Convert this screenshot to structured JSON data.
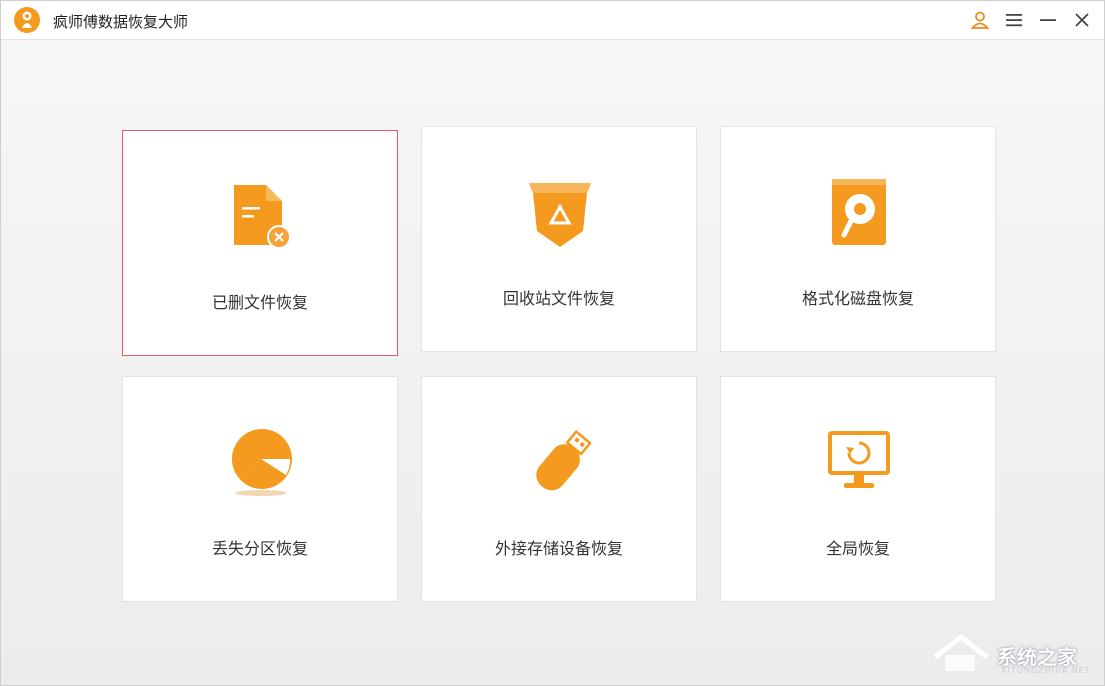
{
  "window": {
    "title": "疯师傅数据恢复大师",
    "accent_color": "#f08a1c"
  },
  "titlebar_controls": {
    "user_icon": "user-icon",
    "menu_icon": "hamburger-menu-icon",
    "minimize_icon": "minimize-icon",
    "close_icon": "close-icon"
  },
  "cards": [
    {
      "label": "已删文件恢复",
      "icon": "deleted-file-icon",
      "selected": true
    },
    {
      "label": "回收站文件恢复",
      "icon": "recycle-bin-icon",
      "selected": false
    },
    {
      "label": "格式化磁盘恢复",
      "icon": "formatted-disk-icon",
      "selected": false
    },
    {
      "label": "丢失分区恢复",
      "icon": "pie-partition-icon",
      "selected": false
    },
    {
      "label": "外接存储设备恢复",
      "icon": "usb-drive-icon",
      "selected": false
    },
    {
      "label": "全局恢复",
      "icon": "monitor-restore-icon",
      "selected": false
    }
  ],
  "watermark": {
    "text": "系统之家",
    "subtext": "XITONGZHIJIA.NET"
  }
}
